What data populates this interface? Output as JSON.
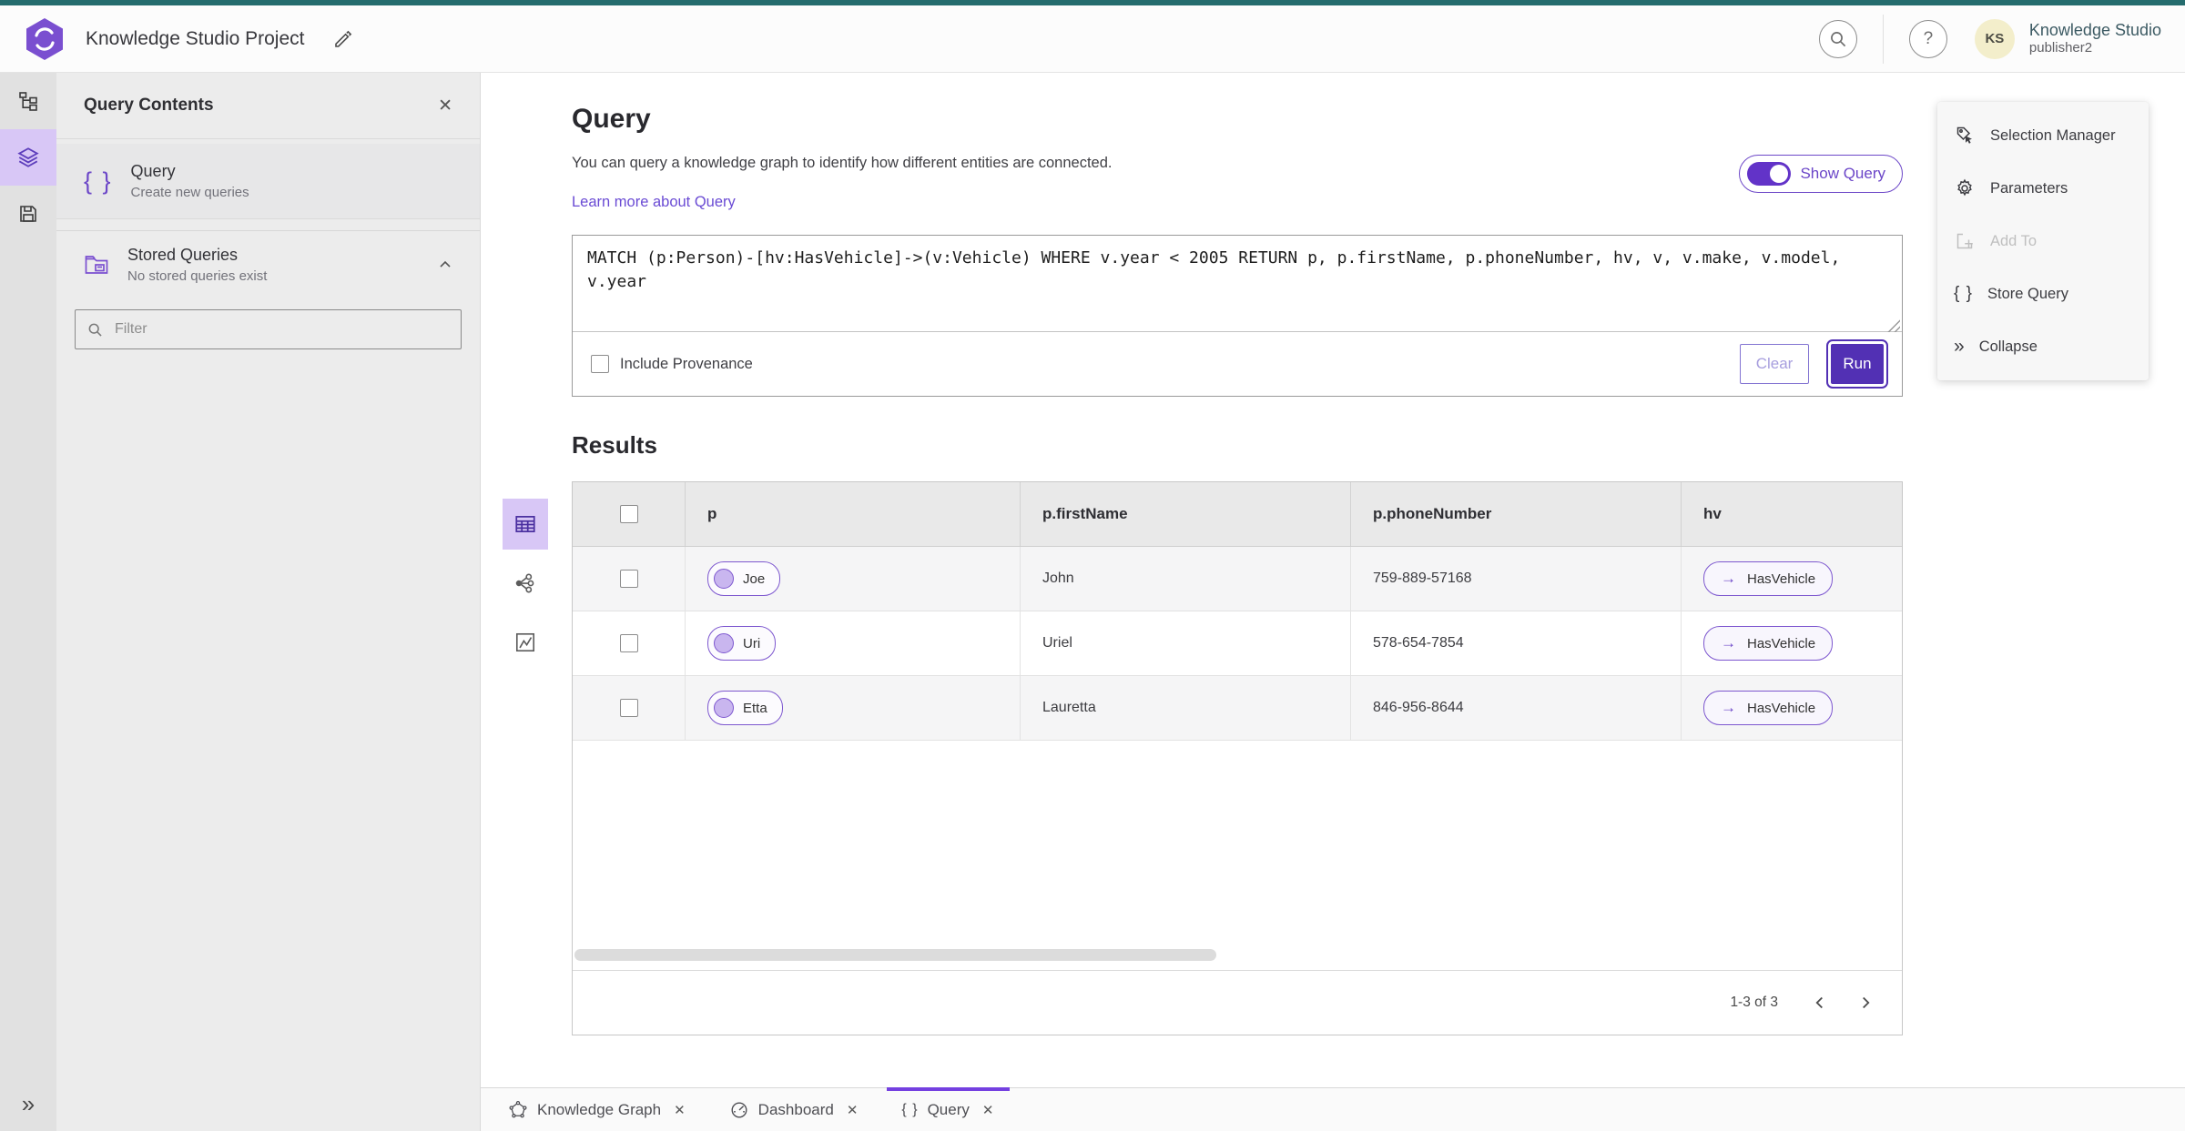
{
  "header": {
    "title": "Knowledge Studio Project",
    "user": {
      "initials": "KS",
      "product": "Knowledge Studio",
      "name": "publisher2"
    }
  },
  "side_panel": {
    "title": "Query Contents",
    "query_item": {
      "title": "Query",
      "subtitle": "Create new queries"
    },
    "stored_item": {
      "title": "Stored Queries",
      "subtitle": "No stored queries exist"
    },
    "filter_placeholder": "Filter"
  },
  "query_section": {
    "title": "Query",
    "description": "You can query a knowledge graph to identify how different entities are connected.",
    "learn_more": "Learn more about Query",
    "show_query_label": "Show Query",
    "query_text": "MATCH (p:Person)-[hv:HasVehicle]->(v:Vehicle) WHERE v.year < 2005 RETURN p, p.firstName, p.phoneNumber, hv, v, v.make, v.model, v.year",
    "include_provenance_label": "Include Provenance",
    "clear_label": "Clear",
    "run_label": "Run"
  },
  "actions_panel": {
    "selection_manager": "Selection Manager",
    "parameters": "Parameters",
    "add_to": "Add To",
    "store_query": "Store Query",
    "collapse": "Collapse"
  },
  "results": {
    "title": "Results",
    "columns": [
      "p",
      "p.firstName",
      "p.phoneNumber",
      "hv"
    ],
    "rows": [
      {
        "node": "Joe",
        "first_name": "John",
        "phone": "759-889-57168",
        "edge": "HasVehicle"
      },
      {
        "node": "Uri",
        "first_name": "Uriel",
        "phone": "578-654-7854",
        "edge": "HasVehicle"
      },
      {
        "node": "Etta",
        "first_name": "Lauretta",
        "phone": "846-956-8644",
        "edge": "HasVehicle"
      }
    ],
    "pagination": {
      "range": "1-3 of 3"
    }
  },
  "tabs": {
    "knowledge_graph": "Knowledge Graph",
    "dashboard": "Dashboard",
    "query": "Query"
  },
  "icons": {
    "close": "✕",
    "braces": "{ }",
    "question": "?",
    "double_chevron": "»",
    "arrow_right": "→"
  },
  "colors": {
    "accent_purple": "#6d48c8",
    "run_button": "#5230b4",
    "active_highlight": "#d8c7f6",
    "top_strip_teal": "#256c6e",
    "link_purple": "#6a4bd4",
    "avatar_bg": "#f3eecb"
  }
}
